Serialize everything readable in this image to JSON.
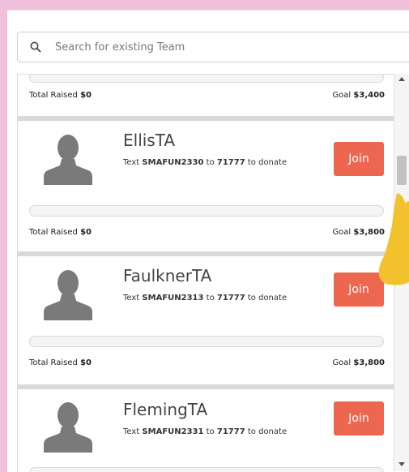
{
  "search": {
    "placeholder": "Search for existing Team",
    "value": ""
  },
  "partial_team": {
    "raised_label": "Total Raised",
    "raised": "$0",
    "goal_label": "Goal",
    "goal": "$3,400"
  },
  "teams": [
    {
      "name": "EllisTA",
      "text_prefix": "Text",
      "code": "SMAFUN2330",
      "to": "to",
      "number": "71777",
      "suffix": "to donate",
      "join_label": "Join",
      "raised_label": "Total Raised",
      "raised": "$0",
      "goal_label": "Goal",
      "goal": "$3,800",
      "progress": 0
    },
    {
      "name": "FaulknerTA",
      "text_prefix": "Text",
      "code": "SMAFUN2313",
      "to": "to",
      "number": "71777",
      "suffix": "to donate",
      "join_label": "Join",
      "raised_label": "Total Raised",
      "raised": "$0",
      "goal_label": "Goal",
      "goal": "$3,800",
      "progress": 0
    },
    {
      "name": "FlemingTA",
      "text_prefix": "Text",
      "code": "SMAFUN2331",
      "to": "to",
      "number": "71777",
      "suffix": "to donate",
      "join_label": "Join",
      "progress": 0
    }
  ],
  "colors": {
    "accent": "#ec6650",
    "background": "#efbfdc",
    "avatar": "#7a7a7a",
    "pointer": "#f2c22d"
  },
  "icons": {
    "search": "search-icon",
    "avatar": "person-silhouette-icon",
    "pointer": "hand-pointer-icon"
  }
}
